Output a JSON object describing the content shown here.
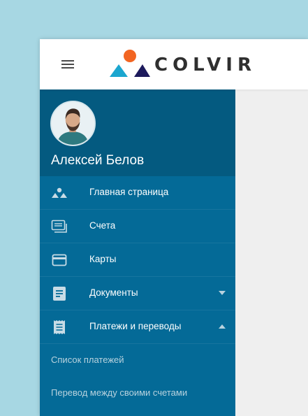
{
  "header": {
    "menu_icon": "hamburger-icon",
    "logo_text": "COLVIR",
    "logo_colors": {
      "circle": "#f26522",
      "triangle_left": "#1ba6cf",
      "triangle_right": "#1d1a5c"
    }
  },
  "profile": {
    "name": "Алексей Белов",
    "avatar_icon": "user-avatar"
  },
  "menu": {
    "items": [
      {
        "label": "Главная страница",
        "icon": "home-triangles-icon"
      },
      {
        "label": "Счета",
        "icon": "accounts-icon"
      },
      {
        "label": "Карты",
        "icon": "card-icon"
      },
      {
        "label": "Документы",
        "icon": "document-icon",
        "caret": "down"
      },
      {
        "label": "Платежи и переводы",
        "icon": "receipt-icon",
        "caret": "up"
      }
    ],
    "sub_items": [
      {
        "label": "Список платежей"
      },
      {
        "label": "Перевод между своими счетами"
      }
    ]
  },
  "colors": {
    "page_bg": "#a7d7e3",
    "sidebar": "#046a97",
    "profile_bg": "#045a80",
    "content_bg": "#efefef"
  }
}
